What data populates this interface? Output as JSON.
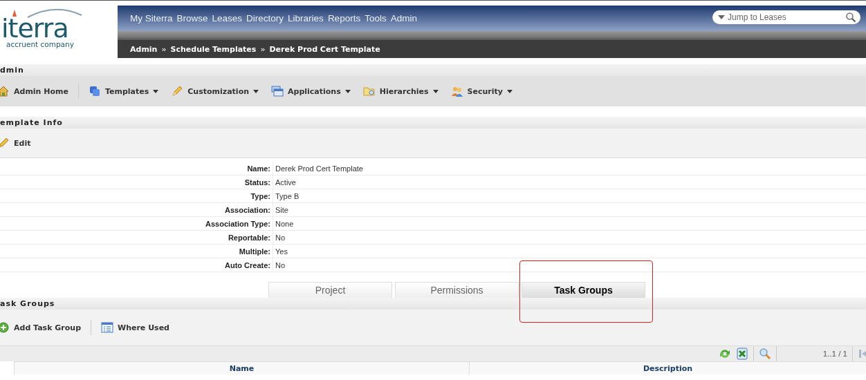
{
  "logo": {
    "name": "iterra",
    "tagline": "accruent company"
  },
  "nav": {
    "items": [
      "My Siterra",
      "Browse",
      "Leases",
      "Directory",
      "Libraries",
      "Reports",
      "Tools",
      "Admin"
    ],
    "search": {
      "placeholder": "Jump to Leases"
    }
  },
  "breadcrumb": [
    "Admin",
    "Schedule Templates",
    "Derek Prod Cert Template"
  ],
  "breadcrumb_separator": "»",
  "admin_section": {
    "title": "dmin",
    "toolbar": [
      {
        "label": "Admin Home",
        "dropdown": false
      },
      {
        "label": "Templates",
        "dropdown": true
      },
      {
        "label": "Customization",
        "dropdown": true
      },
      {
        "label": "Applications",
        "dropdown": true
      },
      {
        "label": "Hierarchies",
        "dropdown": true
      },
      {
        "label": "Security",
        "dropdown": true
      }
    ]
  },
  "template_info": {
    "title": "emplate Info",
    "edit": "Edit",
    "fields": [
      {
        "label": "Name:",
        "value": "Derek Prod Cert Template"
      },
      {
        "label": "Status:",
        "value": "Active"
      },
      {
        "label": "Type:",
        "value": "Type B"
      },
      {
        "label": "Association:",
        "value": "Site"
      },
      {
        "label": "Association Type:",
        "value": "None"
      },
      {
        "label": "Reportable:",
        "value": "No"
      },
      {
        "label": "Multiple:",
        "value": "Yes"
      },
      {
        "label": "Auto Create:",
        "value": "No"
      }
    ]
  },
  "tabs": [
    {
      "label": "Project",
      "selected": false,
      "highlighted": false
    },
    {
      "label": "Permissions",
      "selected": false,
      "highlighted": false
    },
    {
      "label": "Task Groups",
      "selected": true,
      "highlighted": true
    }
  ],
  "task_groups": {
    "title": "ask Groups",
    "toolbar": [
      {
        "label": "Add Task Group"
      },
      {
        "label": "Where Used"
      }
    ],
    "pager": "1..1 / 1",
    "columns": [
      "Name",
      "Description"
    ]
  }
}
